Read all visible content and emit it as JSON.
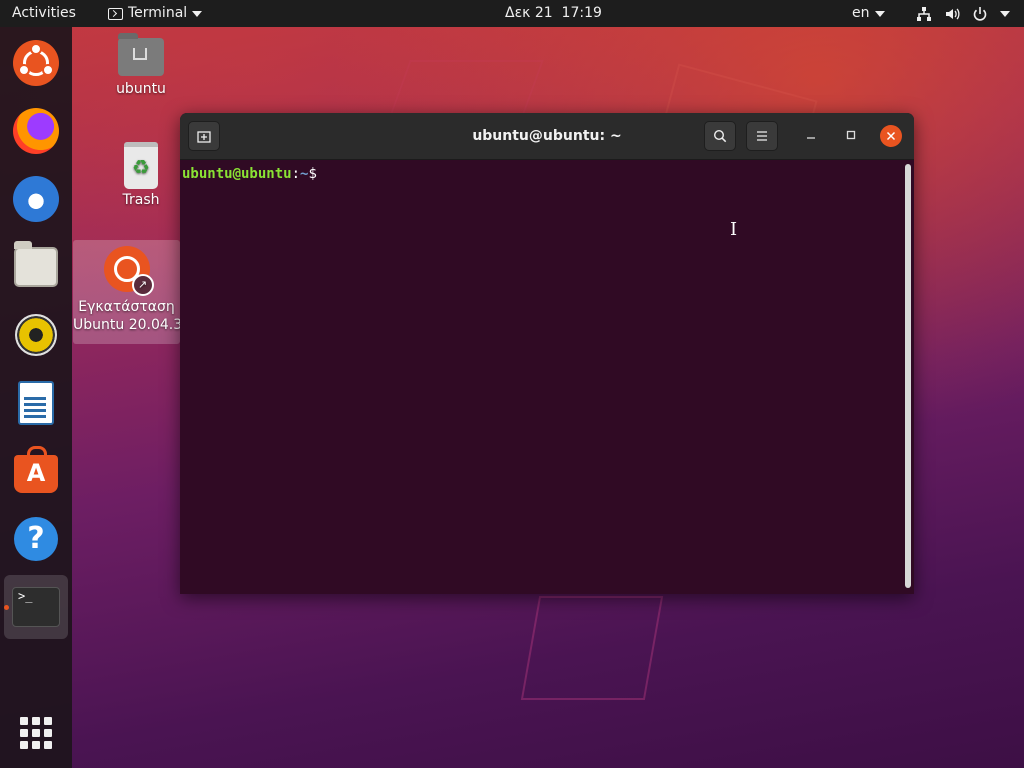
{
  "topbar": {
    "activities": "Activities",
    "app_menu": "Terminal",
    "clock": "Δεκ 21  17:19",
    "language": "en",
    "tray_icons": [
      "network-icon",
      "volume-icon",
      "power-icon"
    ]
  },
  "dock": {
    "items": [
      {
        "name": "Ubuntu",
        "icon": "ubuntu-icon"
      },
      {
        "name": "Firefox",
        "icon": "firefox-icon"
      },
      {
        "name": "Thunderbird",
        "icon": "thunderbird-icon"
      },
      {
        "name": "Files",
        "icon": "files-icon"
      },
      {
        "name": "Rhythmbox",
        "icon": "rhythmbox-icon"
      },
      {
        "name": "LibreOffice Writer",
        "icon": "writer-icon"
      },
      {
        "name": "Ubuntu Software",
        "icon": "software-icon"
      },
      {
        "name": "Help",
        "icon": "help-icon"
      },
      {
        "name": "Terminal",
        "icon": "terminal-icon",
        "active": true
      }
    ],
    "help_glyph": "?",
    "software_glyph": "A",
    "terminal_glyph": ">_"
  },
  "desktop": {
    "home_label": "ubuntu",
    "trash_label": "Trash",
    "installer_line1": "Εγκατάσταση",
    "installer_line2": "Ubuntu 20.04.3"
  },
  "terminal": {
    "title": "ubuntu@ubuntu: ~",
    "prompt_user": "ubuntu@ubuntu",
    "prompt_sep": ":",
    "prompt_path": "~",
    "prompt_symbol": "$"
  },
  "colors": {
    "accent": "#e95420",
    "terminal_bg": "#300a24",
    "prompt_user": "#8ae234",
    "prompt_path": "#729fcf"
  }
}
